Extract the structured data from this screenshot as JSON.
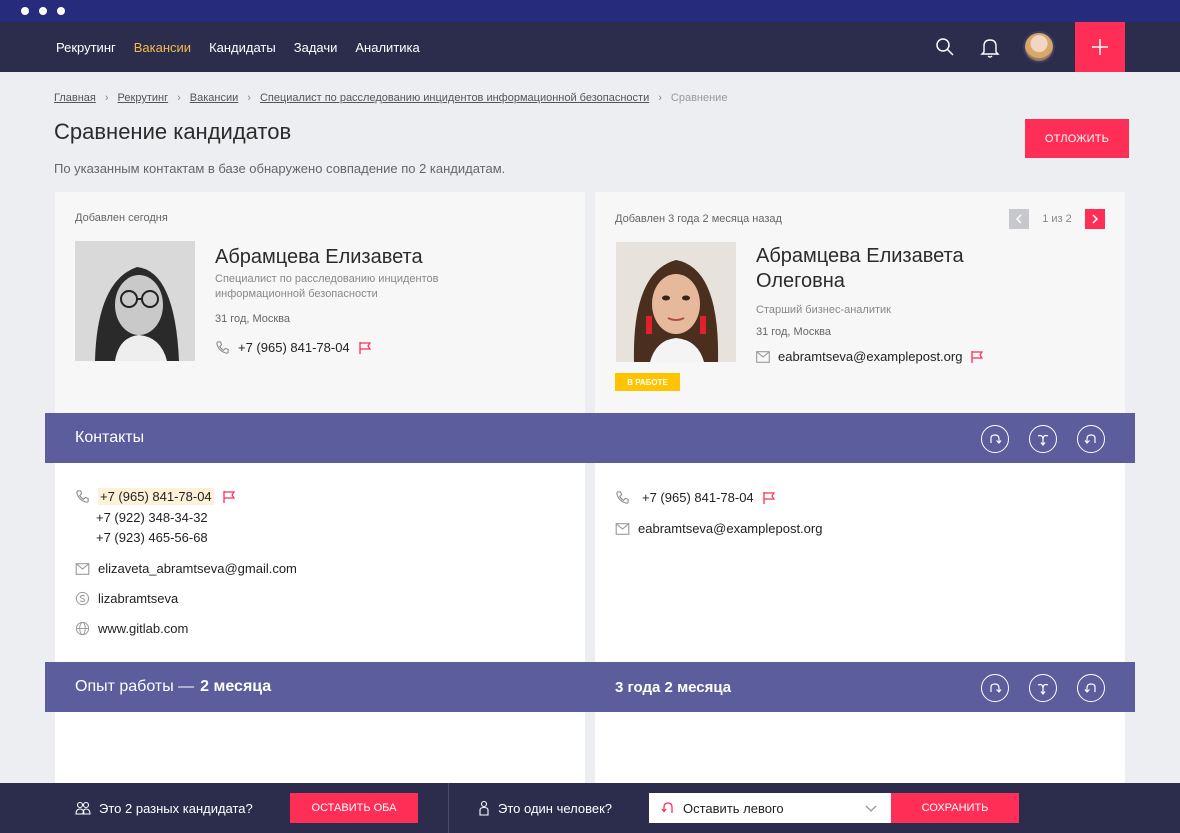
{
  "nav": {
    "items": [
      {
        "label": "Рекрутинг",
        "active": false
      },
      {
        "label": "Вакансии",
        "active": true
      },
      {
        "label": "Кандидаты",
        "active": false
      },
      {
        "label": "Задачи",
        "active": false
      },
      {
        "label": "Аналитика",
        "active": false
      }
    ],
    "icons": [
      "search-icon",
      "bell-icon",
      "avatar",
      "plus-icon"
    ]
  },
  "breadcrumb": {
    "items": [
      "Главная",
      "Рекрутинг",
      "Вакансии",
      "Специалист по расследованию инцидентов информационной безопасности"
    ],
    "current": "Сравнение"
  },
  "page": {
    "title": "Сравнение кандидатов",
    "subtitle": "По указанным контактам в базе обнаружено совпадение по 2 кандидатам.",
    "postpone_label": "ОТЛОЖИТЬ"
  },
  "left": {
    "added": "Добавлен сегодня",
    "name": "Абрамцева Елизавета",
    "position": "Специалист по расследованию инцидентов информационной безопасности",
    "meta": "31 год, Москва",
    "phone": "+7 (965) 841-78-04",
    "contacts": {
      "phones": [
        "+7 (965) 841-78-04",
        "+7 (922) 348-34-32",
        "+7 (923) 465-56-68"
      ],
      "email": "elizaveta_abramtseva@gmail.com",
      "skype": "lizabramtseva",
      "site": "www.gitlab.com"
    }
  },
  "right": {
    "added": "Добавлен 3 года 2 месяца назад",
    "pager": "1 из 2",
    "name_line1": "Абрамцева Елизавета",
    "name_line2": "Олеговна",
    "position": "Старший бизнес-аналитик",
    "meta": "31 год, Москва",
    "email": "eabramtseva@examplepost.org",
    "status_badge": "В РАБОТЕ",
    "contacts": {
      "phone": "+7 (965) 841-78-04",
      "email": "eabramtseva@examplepost.org"
    }
  },
  "sections": {
    "contacts_title": "Контакты",
    "experience_label": "Опыт работы —",
    "experience_left": "2 месяца",
    "experience_right": "3 года 2 месяца"
  },
  "footer": {
    "question_two": "Это 2 разных кандидата?",
    "keep_both": "ОСТАВИТЬ ОБА",
    "question_one": "Это один человек?",
    "select_value": "Оставить левого",
    "save": "СОХРАНИТЬ"
  },
  "colors": {
    "accent": "#ff2e56",
    "nav_bg": "#2c2d4d",
    "band": "#5b5d9c",
    "active_nav": "#f5b94a",
    "badge": "#ffc300"
  }
}
